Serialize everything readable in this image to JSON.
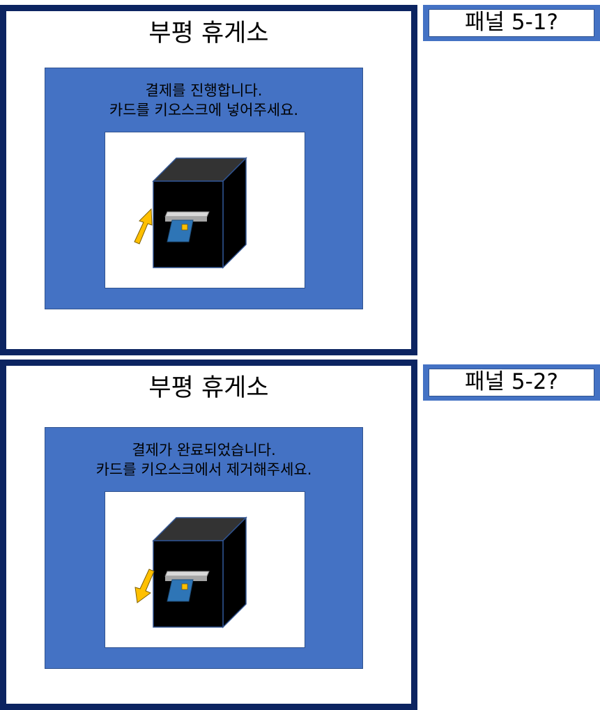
{
  "panels": [
    {
      "title": "부평 휴게소",
      "message_line1": "결제를 진행합니다.",
      "message_line2": "카드를 키오스크에 넣어주세요.",
      "label": "패널 5-1?",
      "arrow_direction": "up"
    },
    {
      "title": "부평 휴게소",
      "message_line1": "결제가 완료되었습니다.",
      "message_line2": "카드를 키오스크에서 제거해주세요.",
      "label": "패널 5-2?",
      "arrow_direction": "down"
    }
  ],
  "colors": {
    "panel_border": "#0c2461",
    "blue_box": "#4472c4",
    "kiosk_body": "#000000",
    "kiosk_top": "#333333",
    "card": "#2e75b6",
    "card_chip": "#ffc000",
    "arrow": "#ffc000"
  },
  "icons": {
    "kiosk": "kiosk-icon",
    "card": "card-icon",
    "arrow_insert": "arrow-up-icon",
    "arrow_remove": "arrow-down-icon"
  }
}
